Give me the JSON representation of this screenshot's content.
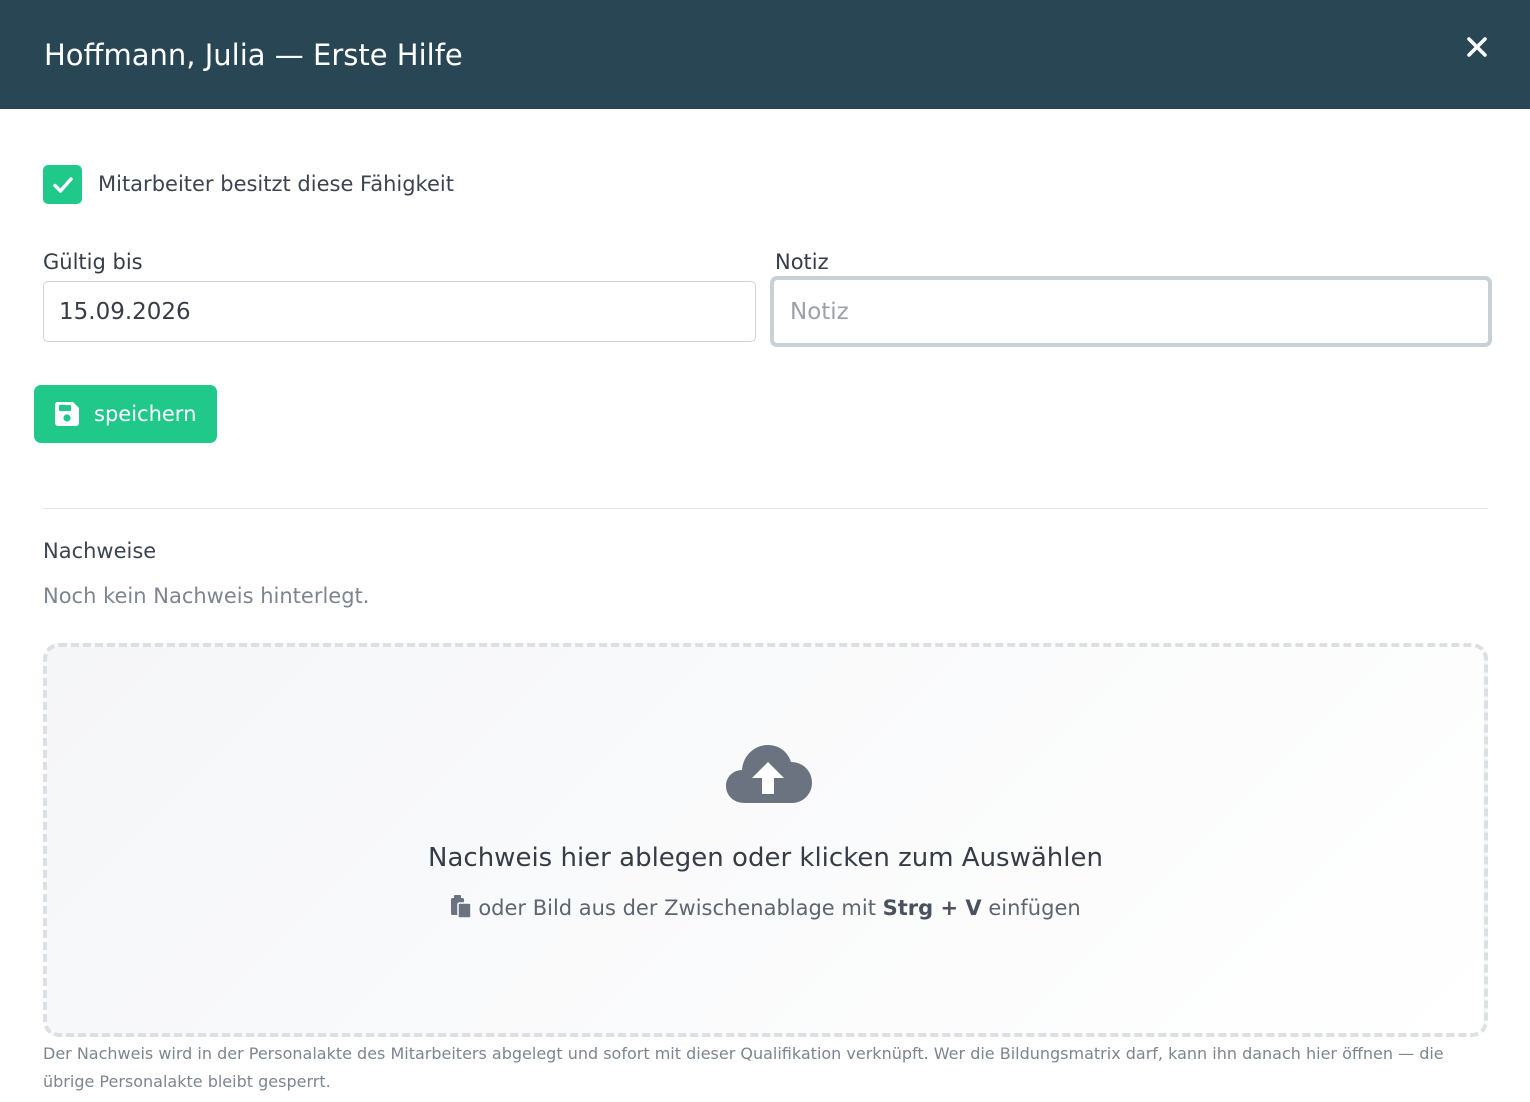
{
  "dialog": {
    "title": "Hoffmann, Julia — Erste Hilfe",
    "close_icon": "close-icon"
  },
  "skill": {
    "has_skill_checked": true,
    "has_skill_label": "Mitarbeiter besitzt diese Fähigkeit"
  },
  "form": {
    "valid_until_label": "Gültig bis",
    "valid_until_value": "15.09.2026",
    "note_label": "Notiz",
    "note_value": "",
    "note_placeholder": "Notiz"
  },
  "save_button": {
    "label": "speichern",
    "icon": "floppy-disk-icon"
  },
  "evidence": {
    "section_title": "Nachweise",
    "empty_text": "Noch kein Nachweis hinterlegt.",
    "dropzone": {
      "icon": "cloud-upload-icon",
      "title": "Nachweis hier ablegen oder klicken zum Auswählen",
      "paste_prefix": "oder Bild aus der Zwischenablage mit",
      "paste_shortcut": "Strg + V",
      "paste_suffix": "einfügen",
      "paste_icon": "clipboard-icon"
    },
    "hint": "Der Nachweis wird in der Personalakte des Mitarbeiters abgelegt und sofort mit dieser Qualifikation verknüpft. Wer die Bildungsmatrix darf, kann ihn danach hier öffnen — die übrige Personalakte bleibt gesperrt."
  },
  "colors": {
    "header_bg": "#294655",
    "accent_green": "#20c98a",
    "text": "#3d4451",
    "muted": "#7d8591"
  }
}
